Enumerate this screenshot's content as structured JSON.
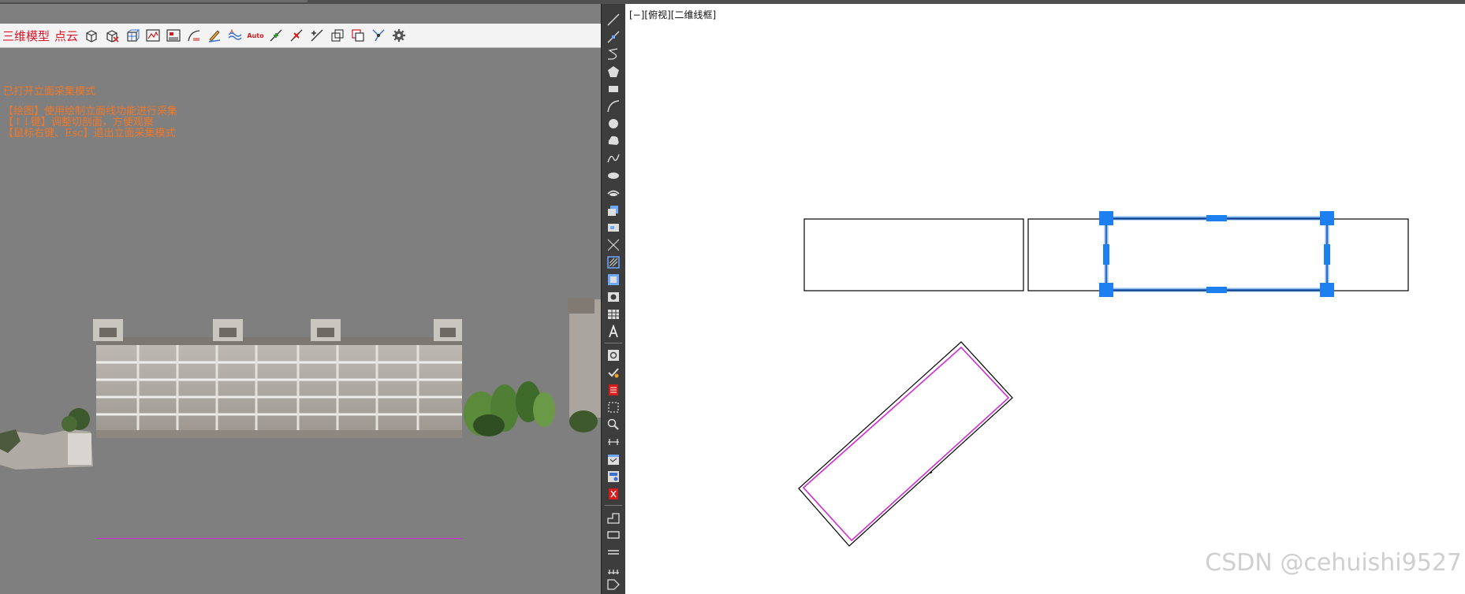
{
  "left_panel": {
    "toolbar": {
      "mode_model": "三维模型",
      "mode_pointcloud": "点云",
      "auto_label": "Auto",
      "icons": [
        "box-icon",
        "box-cut-icon",
        "box-grid-icon",
        "image-chart-icon",
        "image-table-icon",
        "curve-icon",
        "draw-line-icon",
        "wave-icon",
        "auto-icon",
        "snap-point-icon",
        "delete-point-icon",
        "add-point-icon",
        "cube-transform-icon",
        "stack-icon",
        "vertex-icon",
        "settings-icon"
      ]
    },
    "messages": {
      "status": "已打开立面采集模式",
      "hint1": "【绘图】使用绘制立面线功能进行采集",
      "hint2": "【↑↓键】调整切剖面，方便观察",
      "hint3": "【鼠标右键、Esc】退出立面采集模式"
    }
  },
  "right_panel": {
    "view_label": "[−][俯视][二维线框]",
    "watermark": "CSDN @cehuishi9527"
  },
  "colors": {
    "accent_red": "#e0142a",
    "message_orange": "#f0782a",
    "grip_blue": "#1e7ff0",
    "magenta_line": "#d02bd6"
  }
}
